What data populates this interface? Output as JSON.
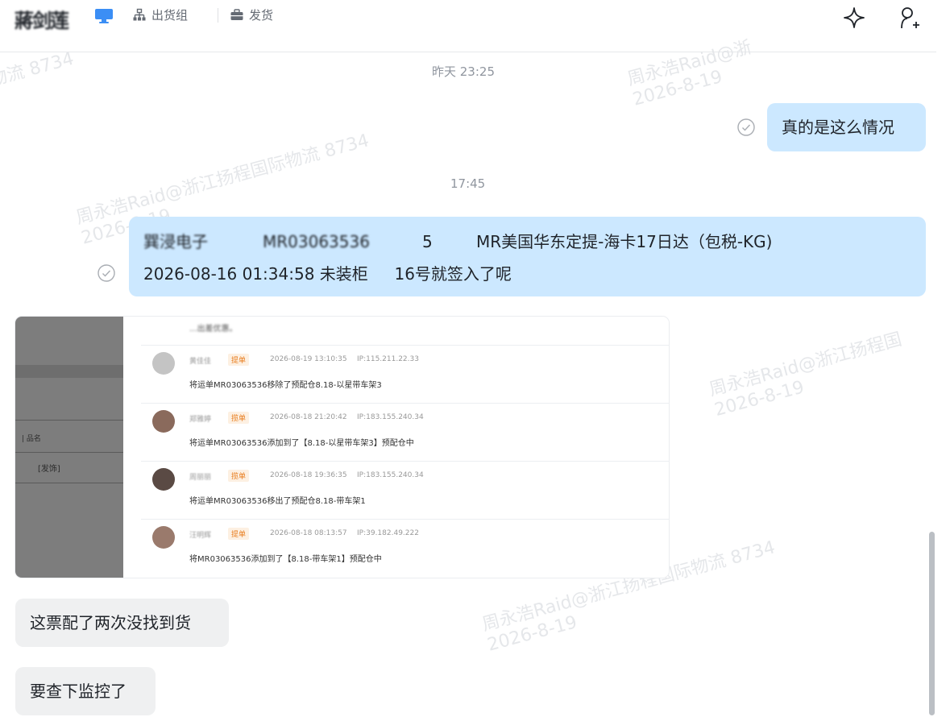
{
  "header": {
    "chat_name": "蔣剑莲",
    "tags": [
      {
        "label": "出货组",
        "icon": "org-chart-icon"
      },
      {
        "label": "发货",
        "icon": "briefcase-icon"
      }
    ],
    "actions": [
      {
        "icon": "sparkle-icon"
      },
      {
        "icon": "add-member-icon"
      }
    ]
  },
  "watermark": {
    "line1": "周永浩Raid@浙江扬程国际物流 8734",
    "line2": "2026-8-19",
    "fragment_a": "物流 8734",
    "fragment_b": "周永浩Raid@浙",
    "fragment_c": "周永浩Raid@浙江扬程国际物流 8734",
    "fragment_d": "周永浩Raid@浙江扬程国"
  },
  "messages": {
    "time1": "昨天 23:25",
    "msg1": "真的是这么情况",
    "time2": "17:45",
    "msg2_line1": {
      "company": "巽浸电子",
      "order": "MR03063536",
      "qty": "5",
      "route": "MR美国华东定提-海卡17日达（包税-KG)"
    },
    "msg2_line2": "2026-08-16 01:34:58 未装柜　  16号就签入了呢",
    "msg3": "这票配了两次没找到货",
    "msg4": "要查下监控了"
  },
  "image_message": {
    "left_col_header": "| 品名",
    "left_col_value": "[发饰]",
    "top_text": "...出差优惠。",
    "entries": [
      {
        "user": "黄佳佳",
        "tag": "提单",
        "time": "2026-08-19 13:10:35",
        "ip": "IP:115.211.22.33",
        "text": "将运单MR03063536移除了预配仓8.18-以星带车架3",
        "avatar": "#c4c4c4"
      },
      {
        "user": "郑雅婷",
        "tag": "揽单",
        "time": "2026-08-18 21:20:42",
        "ip": "IP:183.155.240.34",
        "text": "将运单MR03063536添加到了【8.18-以星带车架3】预配仓中",
        "avatar": "#8a6a5c"
      },
      {
        "user": "周丽丽",
        "tag": "揽单",
        "time": "2026-08-18 19:36:35",
        "ip": "IP:183.155.240.34",
        "text": "将运单MR03063536移出了预配仓8.18-带车架1",
        "avatar": "#5a4a44"
      },
      {
        "user": "汪明辉",
        "tag": "提单",
        "time": "2026-08-18 08:13:57",
        "ip": "IP:39.182.49.222",
        "text": "将MR03063536添加到了【8.18-带车架1】预配仓中",
        "avatar": "#9a7a6c"
      }
    ]
  },
  "colors": {
    "mine_bubble": "#cce8ff",
    "other_bubble": "#eff0f1",
    "tag_orange": "#e87d1e"
  }
}
